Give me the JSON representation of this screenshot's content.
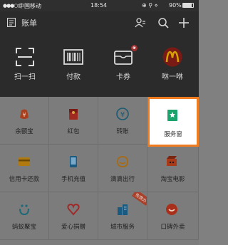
{
  "status": {
    "signal": "●●●○○",
    "carrier": "中国移动",
    "wifi_icon": "wifi-icon",
    "time": "18:54",
    "battery": "90%",
    "icons_text": "⊕ ⚲ ⋄"
  },
  "header": {
    "bill_label": "账单",
    "icons": [
      "contacts-icon",
      "search-icon",
      "add-icon"
    ]
  },
  "top_actions": [
    {
      "label": "扫一扫",
      "icon": "scan-icon"
    },
    {
      "label": "付款",
      "icon": "barcode-icon"
    },
    {
      "label": "卡券",
      "icon": "card-coupon-icon"
    },
    {
      "label": "咻一咻",
      "icon": "mcdonalds-icon"
    }
  ],
  "grid": [
    {
      "label": "余额宝",
      "icon": "yuebao-icon"
    },
    {
      "label": "红包",
      "icon": "red-packet-icon"
    },
    {
      "label": "转账",
      "icon": "transfer-icon"
    },
    {
      "label": "服务窗",
      "icon": "service-window-icon",
      "highlighted": true
    },
    {
      "label": "信用卡还款",
      "icon": "credit-card-icon"
    },
    {
      "label": "手机充值",
      "icon": "phone-recharge-icon"
    },
    {
      "label": "滴滴出行",
      "icon": "didi-icon"
    },
    {
      "label": "淘宝电影",
      "icon": "movie-icon"
    },
    {
      "label": "蚂蚁聚宝",
      "icon": "ant-fortune-icon"
    },
    {
      "label": "爱心捐赠",
      "icon": "donation-icon"
    },
    {
      "label": "城市服务",
      "icon": "city-service-icon",
      "tag": "免费办"
    },
    {
      "label": "口碑外卖",
      "icon": "koubei-icon"
    }
  ],
  "colors": {
    "highlight": "#f07c22",
    "accent_green": "#1aa36b"
  }
}
